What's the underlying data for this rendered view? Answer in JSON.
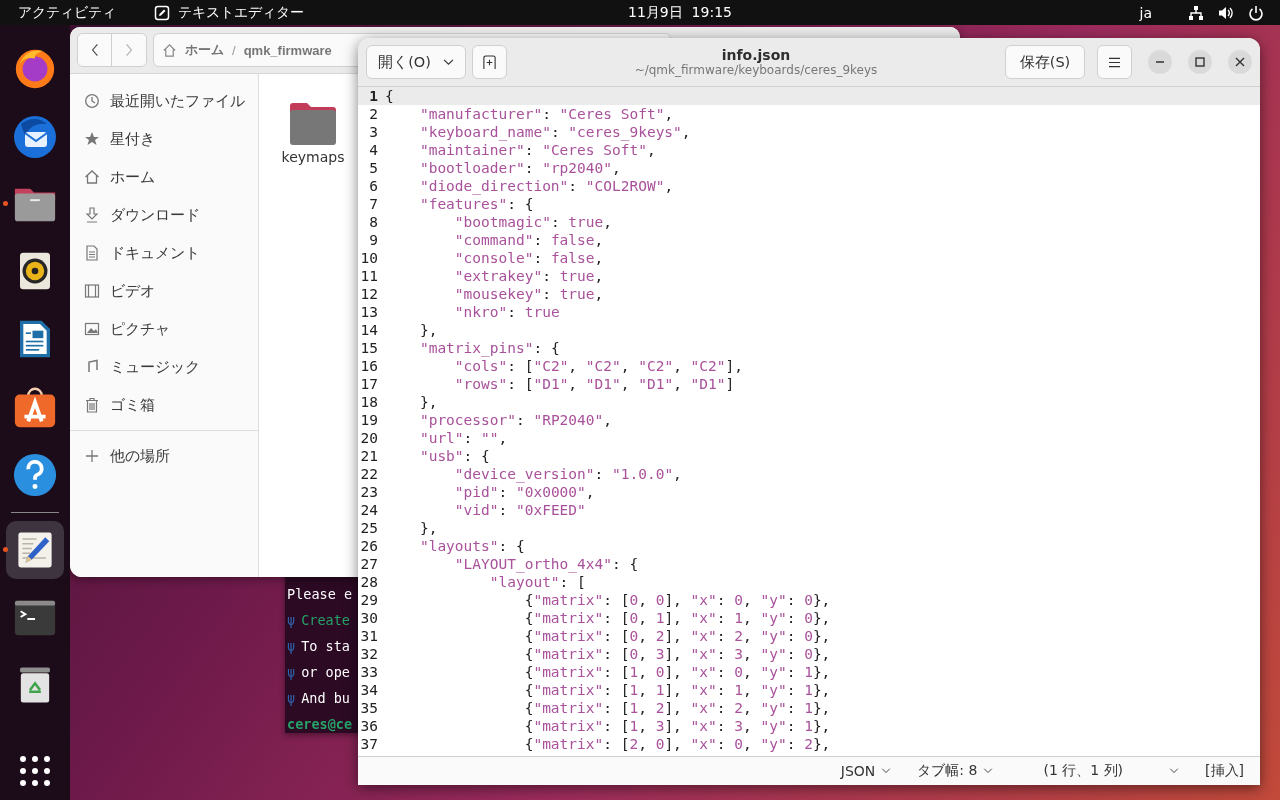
{
  "top_bar": {
    "activities": "アクティビティ",
    "app_name": "テキストエディター",
    "clock": "11月9日  19:15",
    "input_method": "ja"
  },
  "dock": [
    {
      "kind": "browser",
      "running": false,
      "active": false
    },
    {
      "kind": "mail",
      "running": false,
      "active": false
    },
    {
      "kind": "files",
      "running": true,
      "active": false
    },
    {
      "kind": "music",
      "running": false,
      "active": false
    },
    {
      "kind": "writer",
      "running": false,
      "active": false
    },
    {
      "kind": "store",
      "running": false,
      "active": false
    },
    {
      "kind": "help",
      "running": false,
      "active": false
    },
    {
      "kind": "editor",
      "running": true,
      "active": true
    },
    {
      "kind": "terminal",
      "running": false,
      "active": false
    },
    {
      "kind": "trash",
      "running": false,
      "active": false
    },
    {
      "kind": "apps",
      "running": false,
      "active": false
    }
  ],
  "file_manager": {
    "path": [
      "ホーム",
      "qmk_firmware"
    ],
    "path_separator": "/",
    "sidebar": [
      {
        "kind": "recent",
        "label": "最近開いたファイル"
      },
      {
        "kind": "starred",
        "label": "星付き"
      },
      {
        "kind": "home",
        "label": "ホーム"
      },
      {
        "kind": "download",
        "label": "ダウンロード"
      },
      {
        "kind": "document",
        "label": "ドキュメント"
      },
      {
        "kind": "video",
        "label": "ビデオ"
      },
      {
        "kind": "picture",
        "label": "ピクチャ"
      },
      {
        "kind": "music",
        "label": "ミュージック"
      },
      {
        "kind": "trash",
        "label": "ゴミ箱"
      },
      {
        "kind": "other",
        "label": "他の場所"
      }
    ],
    "files": [
      {
        "name": "keymaps"
      }
    ]
  },
  "terminal": {
    "lines": [
      {
        "kind": "plain",
        "text": "Please e",
        "color": "#ffffff"
      },
      {
        "kind": "bullet",
        "mark": "ψ",
        "text": "Create",
        "color": "#26a269"
      },
      {
        "kind": "bullet",
        "mark": "ψ",
        "text": "To sta",
        "color": "#ffffff"
      },
      {
        "kind": "bullet",
        "mark": "ψ",
        "text": "or ope",
        "color": "#ffffff"
      },
      {
        "kind": "bullet",
        "mark": "ψ",
        "text": "And bu",
        "color": "#ffffff"
      },
      {
        "kind": "prompt",
        "text": "ceres@ce",
        "color": "#26a269"
      }
    ]
  },
  "editor": {
    "open_button": "開く(O)",
    "title": "info.json",
    "subtitle": "~/qmk_firmware/keyboards/ceres_9keys",
    "save_button": "保存(S)",
    "lines": [
      {
        "n": "1",
        "text": "{",
        "current": true
      },
      {
        "n": "2",
        "text": "    \"manufacturer\": \"Ceres Soft\",",
        "current": false
      },
      {
        "n": "3",
        "text": "    \"keyboard_name\": \"ceres_9keys\",",
        "current": false
      },
      {
        "n": "4",
        "text": "    \"maintainer\": \"Ceres Soft\",",
        "current": false
      },
      {
        "n": "5",
        "text": "    \"bootloader\": \"rp2040\",",
        "current": false
      },
      {
        "n": "6",
        "text": "    \"diode_direction\": \"COL2ROW\",",
        "current": false
      },
      {
        "n": "7",
        "text": "    \"features\": {",
        "current": false
      },
      {
        "n": "8",
        "text": "        \"bootmagic\": true,",
        "current": false
      },
      {
        "n": "9",
        "text": "        \"command\": false,",
        "current": false
      },
      {
        "n": "10",
        "text": "        \"console\": false,",
        "current": false
      },
      {
        "n": "11",
        "text": "        \"extrakey\": true,",
        "current": false
      },
      {
        "n": "12",
        "text": "        \"mousekey\": true,",
        "current": false
      },
      {
        "n": "13",
        "text": "        \"nkro\": true",
        "current": false
      },
      {
        "n": "14",
        "text": "    },",
        "current": false
      },
      {
        "n": "15",
        "text": "    \"matrix_pins\": {",
        "current": false
      },
      {
        "n": "16",
        "text": "        \"cols\": [\"C2\", \"C2\", \"C2\", \"C2\"],",
        "current": false
      },
      {
        "n": "17",
        "text": "        \"rows\": [\"D1\", \"D1\", \"D1\", \"D1\"]",
        "current": false
      },
      {
        "n": "18",
        "text": "    },",
        "current": false
      },
      {
        "n": "19",
        "text": "    \"processor\": \"RP2040\",",
        "current": false
      },
      {
        "n": "20",
        "text": "    \"url\": \"\",",
        "current": false
      },
      {
        "n": "21",
        "text": "    \"usb\": {",
        "current": false
      },
      {
        "n": "22",
        "text": "        \"device_version\": \"1.0.0\",",
        "current": false
      },
      {
        "n": "23",
        "text": "        \"pid\": \"0x0000\",",
        "current": false
      },
      {
        "n": "24",
        "text": "        \"vid\": \"0xFEED\"",
        "current": false
      },
      {
        "n": "25",
        "text": "    },",
        "current": false
      },
      {
        "n": "26",
        "text": "    \"layouts\": {",
        "current": false
      },
      {
        "n": "27",
        "text": "        \"LAYOUT_ortho_4x4\": {",
        "current": false
      },
      {
        "n": "28",
        "text": "            \"layout\": [",
        "current": false
      },
      {
        "n": "29",
        "text": "                {\"matrix\": [0, 0], \"x\": 0, \"y\": 0},",
        "current": false
      },
      {
        "n": "30",
        "text": "                {\"matrix\": [0, 1], \"x\": 1, \"y\": 0},",
        "current": false
      },
      {
        "n": "31",
        "text": "                {\"matrix\": [0, 2], \"x\": 2, \"y\": 0},",
        "current": false
      },
      {
        "n": "32",
        "text": "                {\"matrix\": [0, 3], \"x\": 3, \"y\": 0},",
        "current": false
      },
      {
        "n": "33",
        "text": "                {\"matrix\": [1, 0], \"x\": 0, \"y\": 1},",
        "current": false
      },
      {
        "n": "34",
        "text": "                {\"matrix\": [1, 1], \"x\": 1, \"y\": 1},",
        "current": false
      },
      {
        "n": "35",
        "text": "                {\"matrix\": [1, 2], \"x\": 2, \"y\": 1},",
        "current": false
      },
      {
        "n": "36",
        "text": "                {\"matrix\": [1, 3], \"x\": 3, \"y\": 1},",
        "current": false
      },
      {
        "n": "37",
        "text": "                {\"matrix\": [2, 0], \"x\": 0, \"y\": 2},",
        "current": false
      }
    ],
    "status_bar": {
      "language": "JSON",
      "tab_width": "タブ幅: 8",
      "position": "(1 行、1 列)",
      "mode": "[挿入]"
    }
  }
}
